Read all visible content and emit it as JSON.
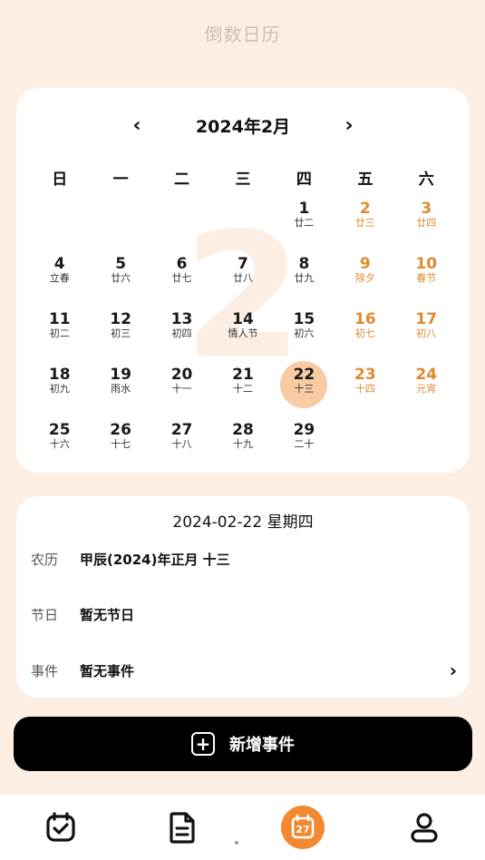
{
  "app": {
    "title": "倒数日历"
  },
  "calendar": {
    "month_label": "2024年2月",
    "prev_symbol": "‹",
    "next_symbol": "›",
    "background_numeral": "2",
    "weekdays": [
      "日",
      "一",
      "二",
      "三",
      "四",
      "五",
      "六"
    ],
    "selected_day": "22",
    "accent_color": "#e08a2e",
    "selected_color": "#f8cba3",
    "weeks": [
      [
        {
          "day": "",
          "lunar": ""
        },
        {
          "day": "",
          "lunar": ""
        },
        {
          "day": "",
          "lunar": ""
        },
        {
          "day": "",
          "lunar": ""
        },
        {
          "day": "1",
          "lunar": "廿二"
        },
        {
          "day": "2",
          "lunar": "廿三"
        },
        {
          "day": "3",
          "lunar": "廿四"
        }
      ],
      [
        {
          "day": "4",
          "lunar": "立春"
        },
        {
          "day": "5",
          "lunar": "廿六"
        },
        {
          "day": "6",
          "lunar": "廿七"
        },
        {
          "day": "7",
          "lunar": "廿八"
        },
        {
          "day": "8",
          "lunar": "廿九"
        },
        {
          "day": "9",
          "lunar": "除夕"
        },
        {
          "day": "10",
          "lunar": "春节"
        }
      ],
      [
        {
          "day": "11",
          "lunar": "初二"
        },
        {
          "day": "12",
          "lunar": "初三"
        },
        {
          "day": "13",
          "lunar": "初四"
        },
        {
          "day": "14",
          "lunar": "情人节"
        },
        {
          "day": "15",
          "lunar": "初六"
        },
        {
          "day": "16",
          "lunar": "初七"
        },
        {
          "day": "17",
          "lunar": "初八"
        }
      ],
      [
        {
          "day": "18",
          "lunar": "初九"
        },
        {
          "day": "19",
          "lunar": "雨水"
        },
        {
          "day": "20",
          "lunar": "十一"
        },
        {
          "day": "21",
          "lunar": "十二"
        },
        {
          "day": "22",
          "lunar": "十三"
        },
        {
          "day": "23",
          "lunar": "十四"
        },
        {
          "day": "24",
          "lunar": "元宵"
        }
      ],
      [
        {
          "day": "25",
          "lunar": "十六"
        },
        {
          "day": "26",
          "lunar": "十七"
        },
        {
          "day": "27",
          "lunar": "十八"
        },
        {
          "day": "28",
          "lunar": "十九"
        },
        {
          "day": "29",
          "lunar": "二十"
        },
        {
          "day": "",
          "lunar": ""
        },
        {
          "day": "",
          "lunar": ""
        }
      ]
    ]
  },
  "detail": {
    "date_line": "2024-02-22 星期四",
    "lunar_label": "农历",
    "lunar_value": "甲辰(2024)年正月 十三",
    "festival_label": "节日",
    "festival_value": "暂无节日",
    "event_label": "事件",
    "event_value": "暂无事件",
    "event_arrow": "›"
  },
  "add_button": {
    "icon": "plus-square-icon",
    "label": "新增事件"
  },
  "tabbar": {
    "active_color": "#f0892f",
    "tabs": [
      {
        "icon": "calendar-check-icon",
        "active": false
      },
      {
        "icon": "document-icon",
        "active": false
      },
      {
        "icon": "calendar-27-icon",
        "active": true,
        "badge": "27"
      },
      {
        "icon": "user-icon",
        "active": false
      }
    ]
  }
}
